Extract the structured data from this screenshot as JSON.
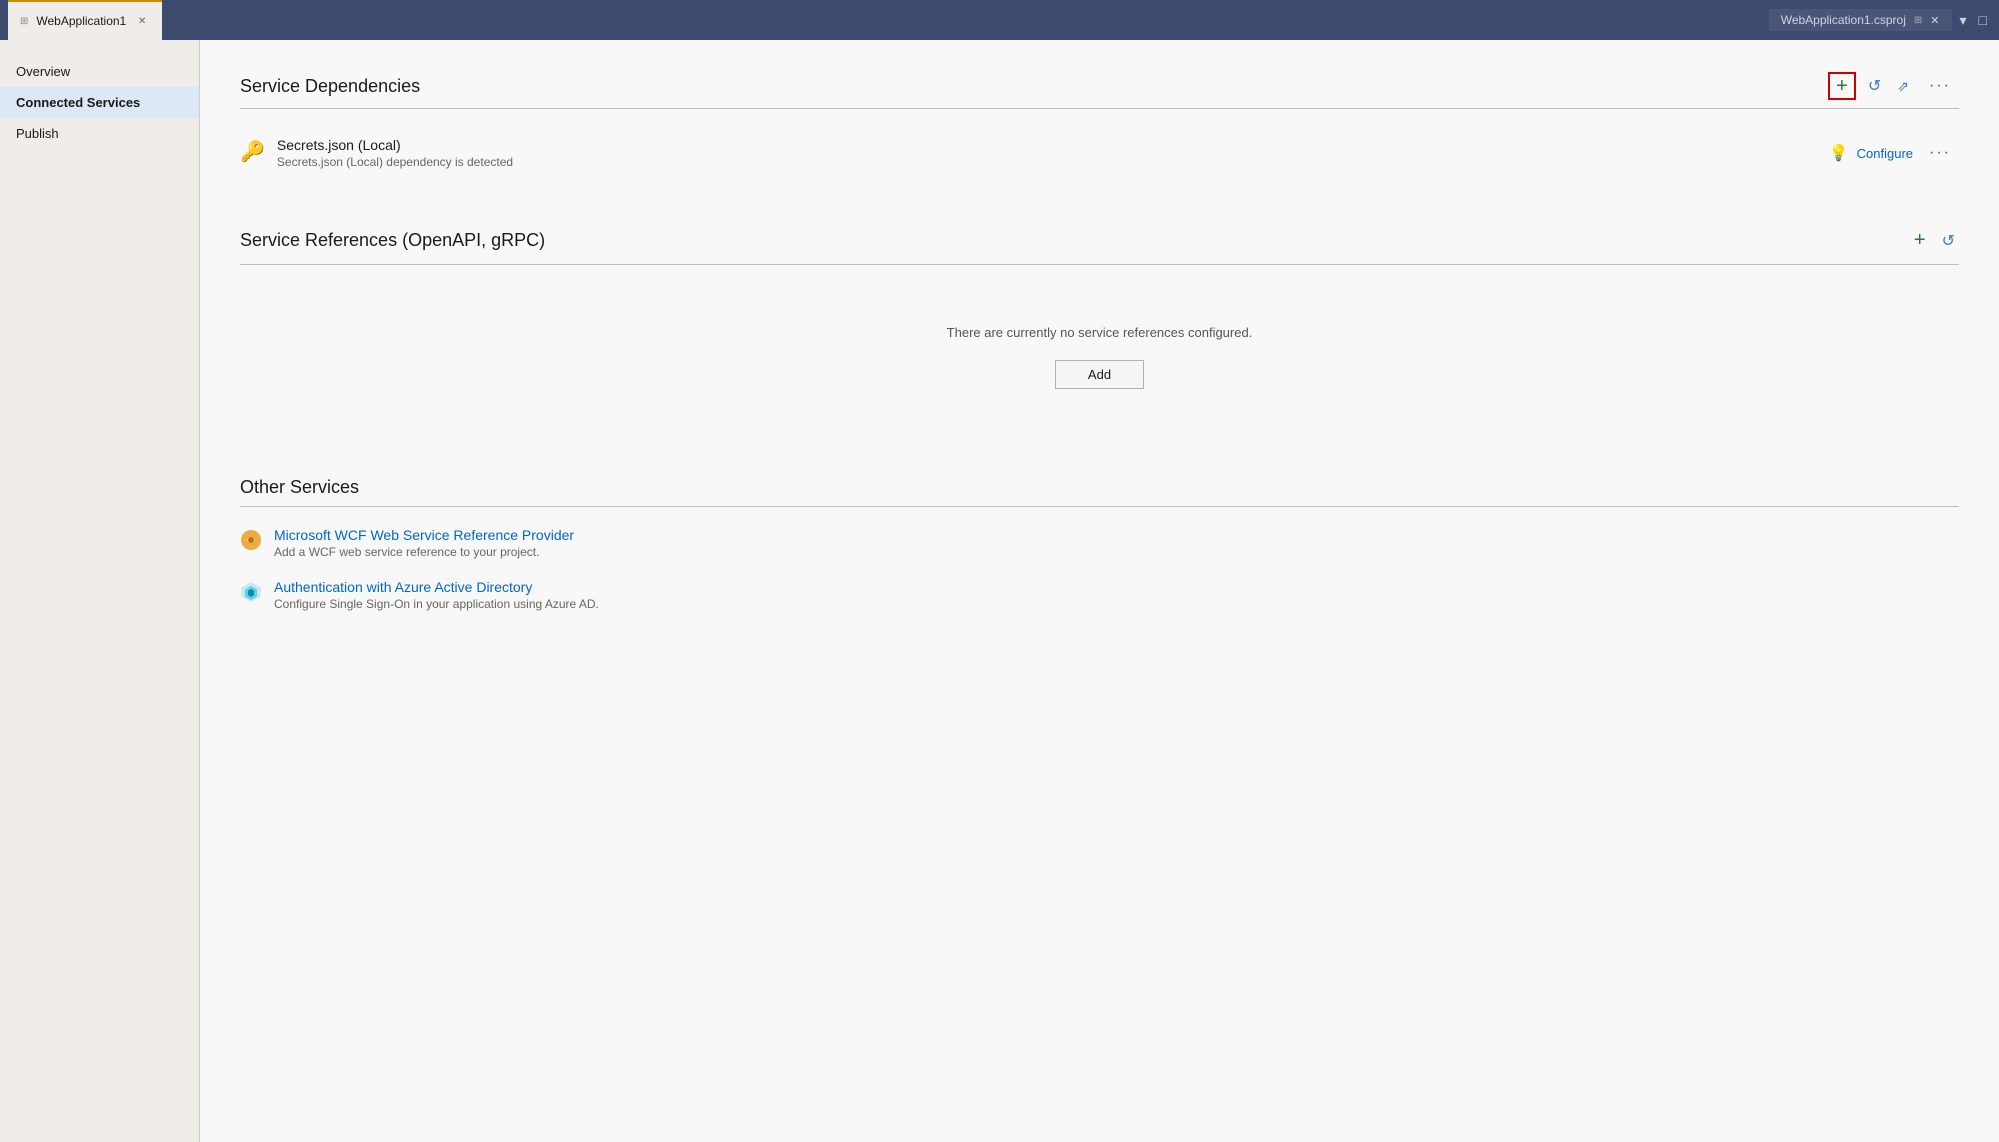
{
  "titlebar": {
    "tab_label": "WebApplication1",
    "pin_icon": "📌",
    "close_icon": "✕",
    "project_label": "WebApplication1.csproj",
    "project_close_icon": "✕",
    "collapse_icon": "▾",
    "maximize_icon": "□"
  },
  "sidebar": {
    "items": [
      {
        "id": "overview",
        "label": "Overview",
        "active": false
      },
      {
        "id": "connected-services",
        "label": "Connected Services",
        "active": true
      },
      {
        "id": "publish",
        "label": "Publish",
        "active": false
      }
    ]
  },
  "service_dependencies": {
    "section_title": "Service Dependencies",
    "add_btn_label": "+",
    "refresh_icon": "↺",
    "link_icon": "🔗",
    "more_icon": "···",
    "items": [
      {
        "name": "Secrets.json (Local)",
        "description": "Secrets.json (Local) dependency is detected",
        "configure_label": "Configure",
        "more_icon": "···"
      }
    ]
  },
  "service_references": {
    "section_title": "Service References (OpenAPI, gRPC)",
    "add_btn_label": "+",
    "refresh_icon": "↺",
    "empty_text": "There are currently no service references configured.",
    "add_button_label": "Add"
  },
  "other_services": {
    "section_title": "Other Services",
    "items": [
      {
        "name": "Microsoft WCF Web Service Reference Provider",
        "description": "Add a WCF web service reference to your project."
      },
      {
        "name": "Authentication with Azure Active Directory",
        "description": "Configure Single Sign-On in your application using Azure AD."
      }
    ]
  }
}
